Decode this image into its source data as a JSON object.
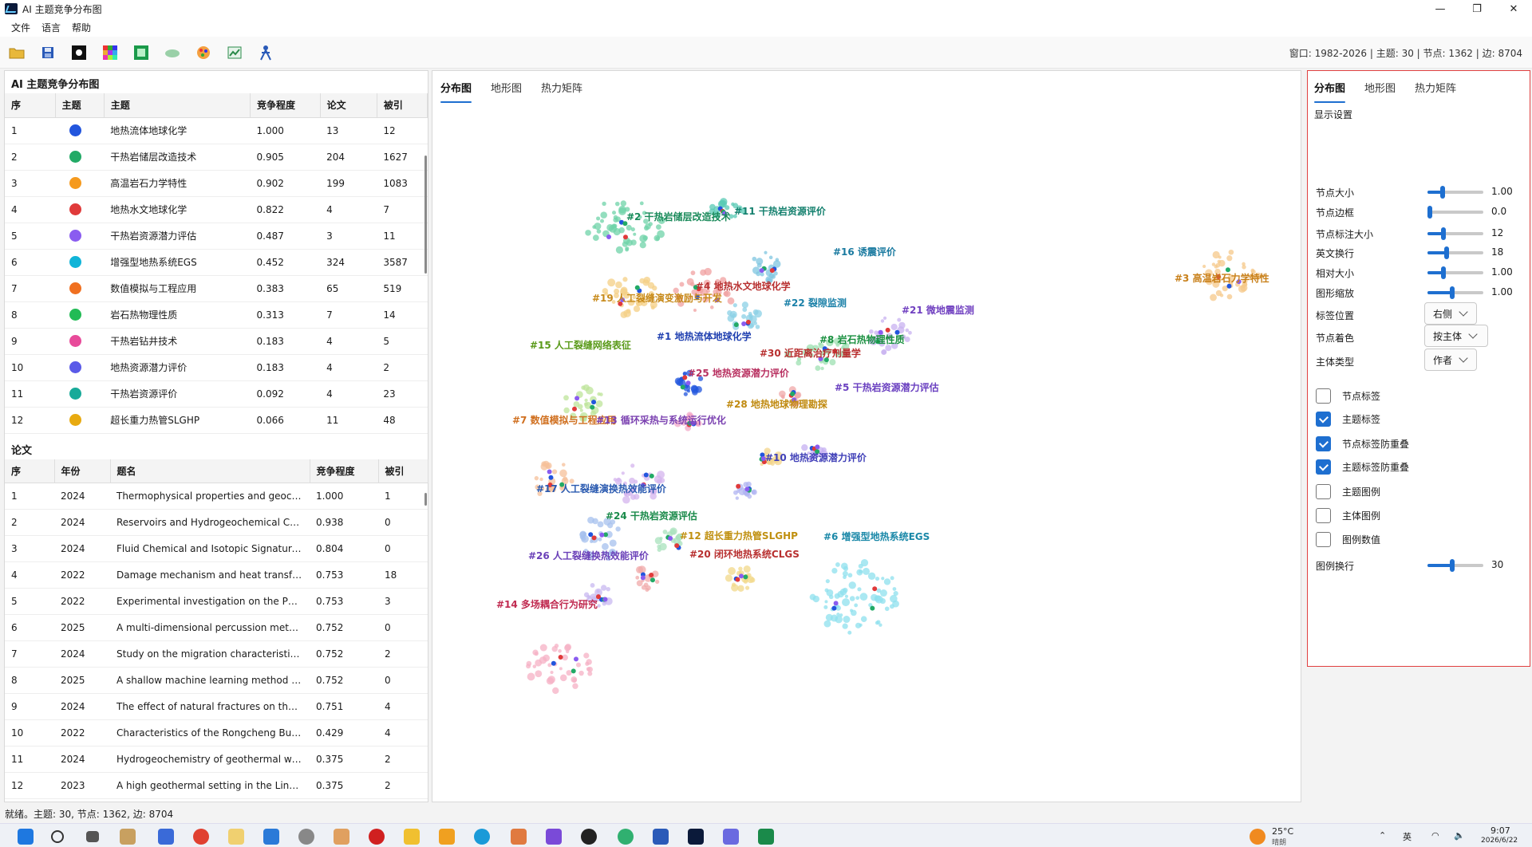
{
  "window": {
    "title": "AI 主题竞争分布图",
    "controls": [
      "—",
      "❐",
      "✕"
    ]
  },
  "menu": [
    "文件",
    "语言",
    "帮助"
  ],
  "toolbar": {
    "icons": [
      "folder-icon",
      "save-icon",
      "dark-theme-icon",
      "color-grid-icon",
      "image-icon",
      "cloud-icon",
      "palette-icon",
      "chart-export-icon",
      "person-icon"
    ],
    "info": "窗口: 1982-2026 | 主题: 30 | 节点: 1362 | 边: 8704"
  },
  "topics": {
    "title": "AI 主题竞争分布图",
    "headers": [
      "序",
      "主题",
      "主题",
      "竞争程度",
      "论文",
      "被引"
    ],
    "rows": [
      {
        "no": "1",
        "color": "#2255dd",
        "name": "地热流体地球化学",
        "score": "1.000",
        "papers": "13",
        "cites": "12"
      },
      {
        "no": "2",
        "color": "#22aa66",
        "name": "干热岩储层改造技术",
        "score": "0.905",
        "papers": "204",
        "cites": "1627"
      },
      {
        "no": "3",
        "color": "#f59a1e",
        "name": "高温岩石力学特性",
        "score": "0.902",
        "papers": "199",
        "cites": "1083"
      },
      {
        "no": "4",
        "color": "#e03a3a",
        "name": "地热水文地球化学",
        "score": "0.822",
        "papers": "4",
        "cites": "7"
      },
      {
        "no": "5",
        "color": "#8a5cf0",
        "name": "干热岩资源潜力评估",
        "score": "0.487",
        "papers": "3",
        "cites": "11"
      },
      {
        "no": "6",
        "color": "#10b4d8",
        "name": "增强型地热系统EGS",
        "score": "0.452",
        "papers": "324",
        "cites": "3587"
      },
      {
        "no": "7",
        "color": "#f07020",
        "name": "数值模拟与工程应用",
        "score": "0.383",
        "papers": "65",
        "cites": "519"
      },
      {
        "no": "8",
        "color": "#22bb55",
        "name": "岩石热物理性质",
        "score": "0.313",
        "papers": "7",
        "cites": "14"
      },
      {
        "no": "9",
        "color": "#e84a9a",
        "name": "干热岩钻井技术",
        "score": "0.183",
        "papers": "4",
        "cites": "5"
      },
      {
        "no": "10",
        "color": "#5a5ae8",
        "name": "地热资源潜力评价",
        "score": "0.183",
        "papers": "4",
        "cites": "2"
      },
      {
        "no": "11",
        "color": "#18aa99",
        "name": "干热岩资源评价",
        "score": "0.092",
        "papers": "4",
        "cites": "23"
      },
      {
        "no": "12",
        "color": "#e8aa10",
        "name": "超长重力热管SLGHP",
        "score": "0.066",
        "papers": "11",
        "cites": "48"
      }
    ]
  },
  "papers": {
    "title": "论文",
    "headers": [
      "序",
      "年份",
      "题名",
      "竞争程度",
      "被引"
    ],
    "rows": [
      {
        "no": "1",
        "year": "2024",
        "title": "Thermophysical properties and geoch...",
        "score": "1.000",
        "cites": "1"
      },
      {
        "no": "2",
        "year": "2024",
        "title": "Reservoirs and Hydrogeochemical Ch...",
        "score": "0.938",
        "cites": "0"
      },
      {
        "no": "3",
        "year": "2024",
        "title": "Fluid Chemical and Isotopic Signature...",
        "score": "0.804",
        "cites": "0"
      },
      {
        "no": "4",
        "year": "2022",
        "title": "Damage mechanism and heat transfer...",
        "score": "0.753",
        "cites": "18"
      },
      {
        "no": "5",
        "year": "2022",
        "title": "Experimental investigation on the PD...",
        "score": "0.753",
        "cites": "3"
      },
      {
        "no": "6",
        "year": "2025",
        "title": "A multi-dimensional percussion meth...",
        "score": "0.752",
        "cites": "0"
      },
      {
        "no": "7",
        "year": "2024",
        "title": "Study on the migration characteristics...",
        "score": "0.752",
        "cites": "2"
      },
      {
        "no": "8",
        "year": "2025",
        "title": "A shallow machine learning method b...",
        "score": "0.752",
        "cites": "0"
      },
      {
        "no": "9",
        "year": "2024",
        "title": "The effect of natural fractures on the ...",
        "score": "0.751",
        "cites": "4"
      },
      {
        "no": "10",
        "year": "2022",
        "title": "Characteristics of the Rongcheng Bul...",
        "score": "0.429",
        "cites": "4"
      },
      {
        "no": "11",
        "year": "2024",
        "title": "Hydrogeochemistry of geothermal wa...",
        "score": "0.375",
        "cites": "2"
      },
      {
        "no": "12",
        "year": "2023",
        "title": "A high geothermal setting in the Linyi ...",
        "score": "0.375",
        "cites": "2"
      }
    ]
  },
  "center_tabs": [
    "分布图",
    "地形图",
    "热力矩阵"
  ],
  "clusters": [
    {
      "label": "#2 干热岩储层改造技术",
      "color": "#1a8a5a",
      "dot": "#6fd3a8"
    },
    {
      "label": "#11 干热岩资源评价",
      "color": "#14806e",
      "dot": "#58c9b4"
    },
    {
      "label": "#16 诱震评价",
      "color": "#1a7aa0",
      "dot": "#7fc6e0"
    },
    {
      "label": "#3 高温岩石力学特性",
      "color": "#c8801a",
      "dot": "#f6c889"
    },
    {
      "label": "#4 地热水文地球化学",
      "color": "#b83030",
      "dot": "#f0a0a0"
    },
    {
      "label": "#19 人工裂缝演变激励与开发",
      "color": "#c78a1a",
      "dot": "#f4cf84"
    },
    {
      "label": "#22 裂隙监测",
      "color": "#1a80a8",
      "dot": "#8bd0e6"
    },
    {
      "label": "#21 微地震监测",
      "color": "#7040c0",
      "dot": "#c8b2f0"
    },
    {
      "label": "#8 岩石热物理性质",
      "color": "#1a9040",
      "dot": "#9ee0b2"
    },
    {
      "label": "#15 人工裂缝网络表征",
      "color": "#5a9a1a",
      "dot": "#bde49a"
    },
    {
      "label": "#1 地热流体地球化学",
      "color": "#2040b0",
      "dot": "#2255dd"
    },
    {
      "label": "#30 近距离治疗剂量学",
      "color": "#b83030",
      "dot": "#f0a8a8"
    },
    {
      "label": "#25 地热资源潜力评价",
      "color": "#b83060",
      "dot": "#f3a8c8"
    },
    {
      "label": "#5 干热岩资源潜力评估",
      "color": "#6a40c0",
      "dot": "#c6b0f2"
    },
    {
      "label": "#28 地热地球物理勘探",
      "color": "#c08a10",
      "dot": "#f3d48a"
    },
    {
      "label": "#7 数值模拟与工程应用",
      "color": "#d07020",
      "dot": "#f6c09a"
    },
    {
      "label": "#13 循环采热与系统运行优化",
      "color": "#7a40b0",
      "dot": "#d4b4ee"
    },
    {
      "label": "#10 地热资源潜力评价",
      "color": "#4040b8",
      "dot": "#b0b4f2"
    },
    {
      "label": "#17 人工裂缝演换热效能评价",
      "color": "#2a5ab0",
      "dot": "#a6c0ee"
    },
    {
      "label": "#24 干热岩资源评估",
      "color": "#1a8a4a",
      "dot": "#a8e2bc"
    },
    {
      "label": "#20 闭环地热系统CLGS",
      "color": "#b83030",
      "dot": "#f0aaaa"
    },
    {
      "label": "#12 超长重力热管SLGHP",
      "color": "#c09010",
      "dot": "#f2d88a"
    },
    {
      "label": "#26 人工裂缝换热效能评价",
      "color": "#6a40b8",
      "dot": "#c8b8f0"
    },
    {
      "label": "#6 增强型地热系统EGS",
      "color": "#1a88a8",
      "dot": "#8ee0ee"
    },
    {
      "label": "#14 多场耦合行为研究",
      "color": "#c02a50",
      "dot": "#f6b0c4"
    }
  ],
  "right": {
    "tabs": [
      "分布图",
      "地形图",
      "热力矩阵"
    ],
    "section": "显示设置",
    "sliders": [
      {
        "label": "节点大小",
        "value": "1.00",
        "level": 0.25
      },
      {
        "label": "节点边框",
        "value": "0.0",
        "level": 0.0
      },
      {
        "label": "节点标注大小",
        "value": "12",
        "level": 0.27
      },
      {
        "label": "英文换行",
        "value": "18",
        "level": 0.33
      },
      {
        "label": "相对大小",
        "value": "1.00",
        "level": 0.27
      },
      {
        "label": "图形缩放",
        "value": "1.00",
        "level": 0.43
      }
    ],
    "dropdowns": [
      {
        "label": "标签位置",
        "value": "右侧"
      },
      {
        "label": "节点着色",
        "value": "按主体"
      },
      {
        "label": "主体类型",
        "value": "作者"
      }
    ],
    "checkboxes": [
      {
        "label": "节点标签",
        "checked": false
      },
      {
        "label": "主题标签",
        "checked": true
      },
      {
        "label": "节点标签防重叠",
        "checked": true
      },
      {
        "label": "主题标签防重叠",
        "checked": true
      },
      {
        "label": "主题图例",
        "checked": false
      },
      {
        "label": "主体图例",
        "checked": false
      },
      {
        "label": "图例数值",
        "checked": false
      }
    ],
    "legend_wrap": {
      "label": "图例换行",
      "value": "30",
      "level": 0.43
    }
  },
  "status": "就绪。主题: 30, 节点: 1362, 边: 8704",
  "taskbar": {
    "weather": "25°C",
    "weather_sub": "晴朗",
    "ime": "英",
    "time": "9:07",
    "date": "2026/6/22"
  }
}
